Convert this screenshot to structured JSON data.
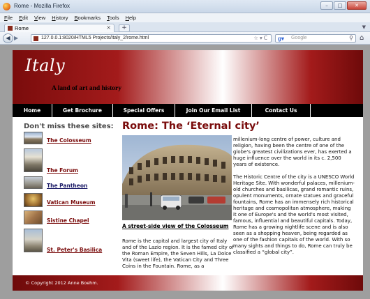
{
  "window": {
    "title": "Rome - Mozilla Firefox"
  },
  "menubar": [
    "File",
    "Edit",
    "View",
    "History",
    "Bookmarks",
    "Tools",
    "Help"
  ],
  "tabs": [
    {
      "label": "Rome"
    }
  ],
  "navbar": {
    "url": "127.0.0.1:8020/HTML5 Projects/italy_2/rome.html",
    "search_placeholder": "Google"
  },
  "site": {
    "title": "Italy",
    "tagline": "A land of art and history",
    "nav": [
      "Home",
      "Get Brochure",
      "Special Offers",
      "Join Our Email List",
      "Contact Us"
    ],
    "sidebar_title": "Don't miss these sites:",
    "sidebar_items": [
      "The Colosseum",
      "The Forum",
      "The Pantheon",
      "Vatican Museum",
      "Sistine Chapel",
      "St. Peter's Basilica"
    ],
    "main_title": "Rome: The ‘Eternal city’",
    "photo_caption": "A street-side view of the Colosseum",
    "para1": "Rome is the capital and largest city of Italy and of the Lazio region. It is the famed city of the Roman Empire, the Seven Hills, La Dolce Vita (sweet life), the Vatican City and Three Coins in the Fountain. Rome, as a",
    "para2": "millenium-long centre of power, culture and religion, having been the centre of one of the globe's greatest civilizations ever, has exerted a huge influence over the world in its c. 2,500 years of existence.",
    "para3": "The Historic Centre of the city is a UNESCO World Heritage Site. With wonderful palaces, millenium-old churches and basilicas, grand romantic ruins, opulent monuments, ornate statues and graceful fountains, Rome has an immensely rich historical heritage and cosmopolitan atmosphere, making it one of Europe's and the world's most visited, famous, influential and beautiful capitals. Today, Rome has a growing nightlife scene and is also seen as a shopping heaven, being regarded as one of the fashion capitals of the world. With so many sights and things to do, Rome can truly be classified a “global city”.",
    "footer": "© Copyright 2012 Anne Boehm."
  },
  "colors": {
    "accent": "#7a0c0c",
    "nav_bg": "#000000",
    "viewport_bg": "#9e9e9e"
  }
}
